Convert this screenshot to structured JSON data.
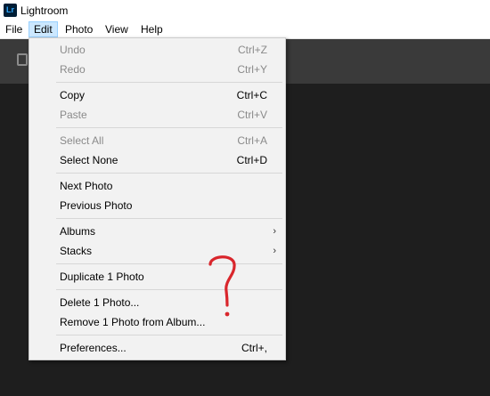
{
  "app": {
    "logo_text": "Lr",
    "title": "Lightroom"
  },
  "menubar": {
    "items": [
      "File",
      "Edit",
      "Photo",
      "View",
      "Help"
    ],
    "active": "Edit"
  },
  "edit_menu": {
    "items": [
      {
        "label": "Undo",
        "shortcut": "Ctrl+Z",
        "enabled": false
      },
      {
        "label": "Redo",
        "shortcut": "Ctrl+Y",
        "enabled": false
      },
      {
        "label": "Copy",
        "shortcut": "Ctrl+C",
        "enabled": true
      },
      {
        "label": "Paste",
        "shortcut": "Ctrl+V",
        "enabled": false
      },
      {
        "label": "Select All",
        "shortcut": "Ctrl+A",
        "enabled": false
      },
      {
        "label": "Select None",
        "shortcut": "Ctrl+D",
        "enabled": true
      },
      {
        "label": "Next Photo",
        "shortcut": "",
        "enabled": true
      },
      {
        "label": "Previous Photo",
        "shortcut": "",
        "enabled": true
      },
      {
        "label": "Albums",
        "shortcut": "",
        "enabled": true,
        "submenu": true
      },
      {
        "label": "Stacks",
        "shortcut": "",
        "enabled": true,
        "submenu": true
      },
      {
        "label": "Duplicate 1 Photo",
        "shortcut": "",
        "enabled": true
      },
      {
        "label": "Delete 1 Photo...",
        "shortcut": "",
        "enabled": true
      },
      {
        "label": "Remove 1 Photo from Album...",
        "shortcut": "",
        "enabled": true
      },
      {
        "label": "Preferences...",
        "shortcut": "Ctrl+,",
        "enabled": true
      }
    ]
  },
  "colors": {
    "active_menu_bg": "#cce8ff",
    "menu_bg": "#f2f2f2",
    "disabled_text": "#8a8a8a",
    "annotation": "#d9262c",
    "dark_bg": "#1e1e1e",
    "toolbar_bg": "#3a3a3a"
  },
  "icons": {
    "app_logo": "lightroom-logo-icon",
    "submenu_arrow": "chevron-right-icon",
    "toolbar": "filmstrip-icon",
    "annotation": "question-mark-annotation-icon"
  }
}
